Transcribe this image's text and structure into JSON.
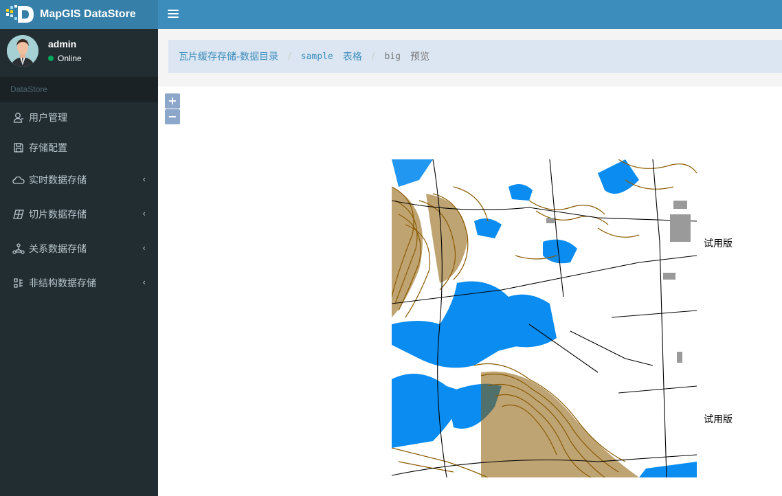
{
  "app": {
    "title": "MapGIS DataStore",
    "brand_colors": {
      "header": "#3c8dbc",
      "logo_bar": "#367fa9",
      "sidebar": "#222d32"
    }
  },
  "user": {
    "name": "admin",
    "status": "Online"
  },
  "sidebar": {
    "header": "DataStore",
    "items": [
      {
        "label": "用户管理",
        "icon": "user-icon",
        "expandable": false
      },
      {
        "label": "存储配置",
        "icon": "floppy-disk-icon",
        "expandable": false
      },
      {
        "label": "实时数据存储",
        "icon": "cloud-icon",
        "expandable": true
      },
      {
        "label": "切片数据存储",
        "icon": "grid-tiles-icon",
        "expandable": true
      },
      {
        "label": "关系数据存储",
        "icon": "network-nodes-icon",
        "expandable": true
      },
      {
        "label": "非结构数据存储",
        "icon": "structure-icon",
        "expandable": true
      }
    ]
  },
  "breadcrumb": {
    "root": "瓦片缓存存储-数据目录",
    "db": "sample",
    "db_suffix": "表格",
    "table": "big",
    "action": "预览"
  },
  "map": {
    "zoom_in": "+",
    "zoom_out": "−",
    "watermarks": [
      "试用版",
      "试用版"
    ]
  }
}
